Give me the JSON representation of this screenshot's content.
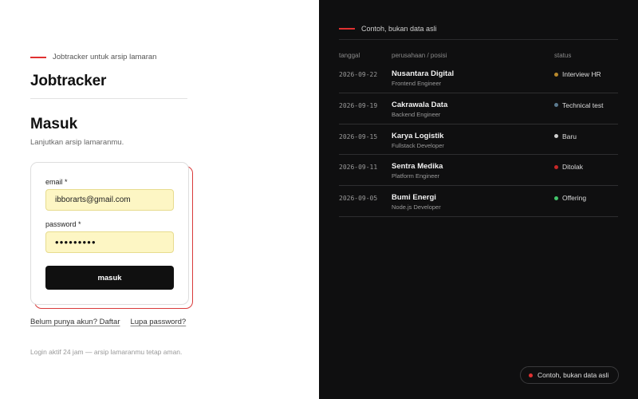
{
  "left": {
    "eyebrow": "Jobtracker untuk arsip lamaran",
    "brand": "Jobtracker",
    "title": "Masuk",
    "subtitle": "Lanjutkan arsip lamaranmu.",
    "form": {
      "email_label": "email *",
      "email_value": "ibborarts@gmail.com",
      "password_label": "password *",
      "password_value": "•••••••••",
      "submit_label": "masuk"
    },
    "links": {
      "register": "Belum punya akun? Daftar",
      "forgot": "Lupa password?"
    },
    "footnote": "Login aktif 24 jam — arsip lamaranmu tetap aman."
  },
  "right": {
    "eyebrow": "Contoh, bukan data asli",
    "headers": {
      "date": "tanggal",
      "company": "perusahaan / posisi",
      "status": "status"
    },
    "rows": [
      {
        "date": "2026-09-22",
        "company": "Nusantara Digital",
        "role": "Frontend Engineer",
        "status": "Interview HR",
        "color": "#b9892c"
      },
      {
        "date": "2026-09-19",
        "company": "Cakrawala Data",
        "role": "Backend Engineer",
        "status": "Technical test",
        "color": "#5b7a8f"
      },
      {
        "date": "2026-09-15",
        "company": "Karya Logistik",
        "role": "Fullstack Developer",
        "status": "Baru",
        "color": "#cfcfcf"
      },
      {
        "date": "2026-09-11",
        "company": "Sentra Medika",
        "role": "Platform Engineer",
        "status": "Ditolak",
        "color": "#c62828"
      },
      {
        "date": "2026-09-05",
        "company": "Bumi Energi",
        "role": "Node.js Developer",
        "status": "Offering",
        "color": "#43c56b"
      }
    ],
    "badge": "Contoh, bukan data asli"
  },
  "colors": {
    "accent": "#e03131",
    "input_bg": "#fdf6c4",
    "button_bg": "#101010",
    "dark_bg": "#0f0f10"
  }
}
